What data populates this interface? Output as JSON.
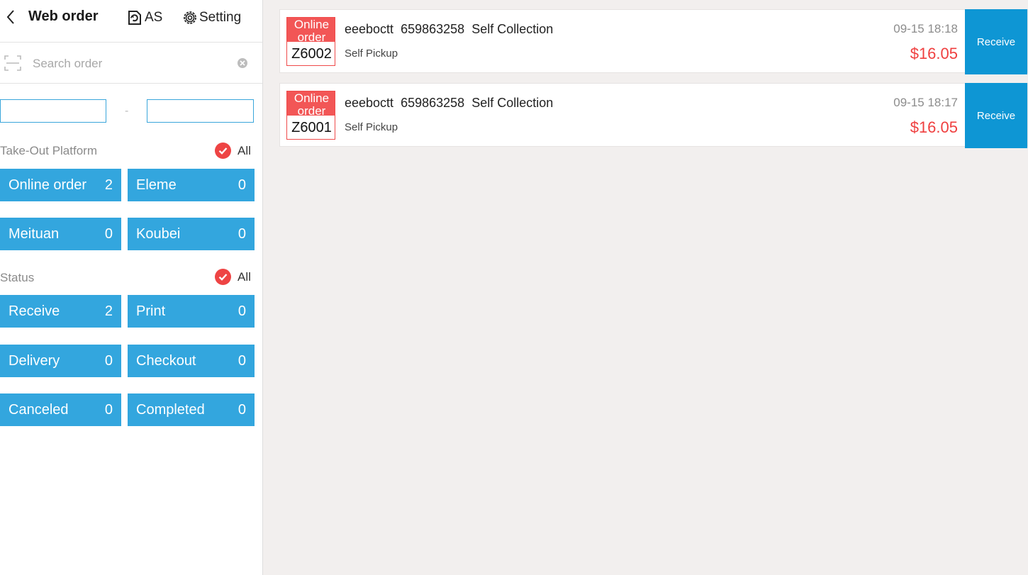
{
  "header": {
    "title": "Web order",
    "as_label": "AS",
    "setting_label": "Setting"
  },
  "search": {
    "placeholder": "Search order",
    "value": ""
  },
  "date_range": {
    "start": "",
    "separator": "-",
    "end": ""
  },
  "platform_filter": {
    "label": "Take-Out Platform",
    "all_label": "All",
    "items": [
      {
        "label": "Online order",
        "count": "2"
      },
      {
        "label": "Eleme",
        "count": "0"
      },
      {
        "label": "Meituan",
        "count": "0"
      },
      {
        "label": "Koubei",
        "count": "0"
      }
    ]
  },
  "status_filter": {
    "label": "Status",
    "all_label": "All",
    "items": [
      {
        "label": "Receive",
        "count": "2"
      },
      {
        "label": "Print",
        "count": "0"
      },
      {
        "label": "Delivery",
        "count": "0"
      },
      {
        "label": "Checkout",
        "count": "0"
      },
      {
        "label": "Canceled",
        "count": "0"
      },
      {
        "label": "Completed",
        "count": "0"
      }
    ]
  },
  "orders": [
    {
      "badge": "Online order",
      "number": "Z6002",
      "customer": "eeeboctt",
      "phone": "659863258",
      "type": "Self Collection",
      "pickup": "Self Pickup",
      "time": "09-15 18:18",
      "price": "$16.05",
      "action": "Receive"
    },
    {
      "badge": "Online order",
      "number": "Z6001",
      "customer": "eeeboctt",
      "phone": "659863258",
      "type": "Self Collection",
      "pickup": "Self Pickup",
      "time": "09-15 18:17",
      "price": "$16.05",
      "action": "Receive"
    }
  ],
  "colors": {
    "accent": "#33a6de",
    "receive_button": "#0e96d4",
    "badge_red": "#f25656",
    "price_red": "#ef3f3f",
    "check_red": "#ee4444"
  },
  "icons": [
    "chevron-left-icon",
    "as-icon",
    "gear-icon",
    "scan-icon",
    "clear-icon",
    "check-circle-icon"
  ]
}
